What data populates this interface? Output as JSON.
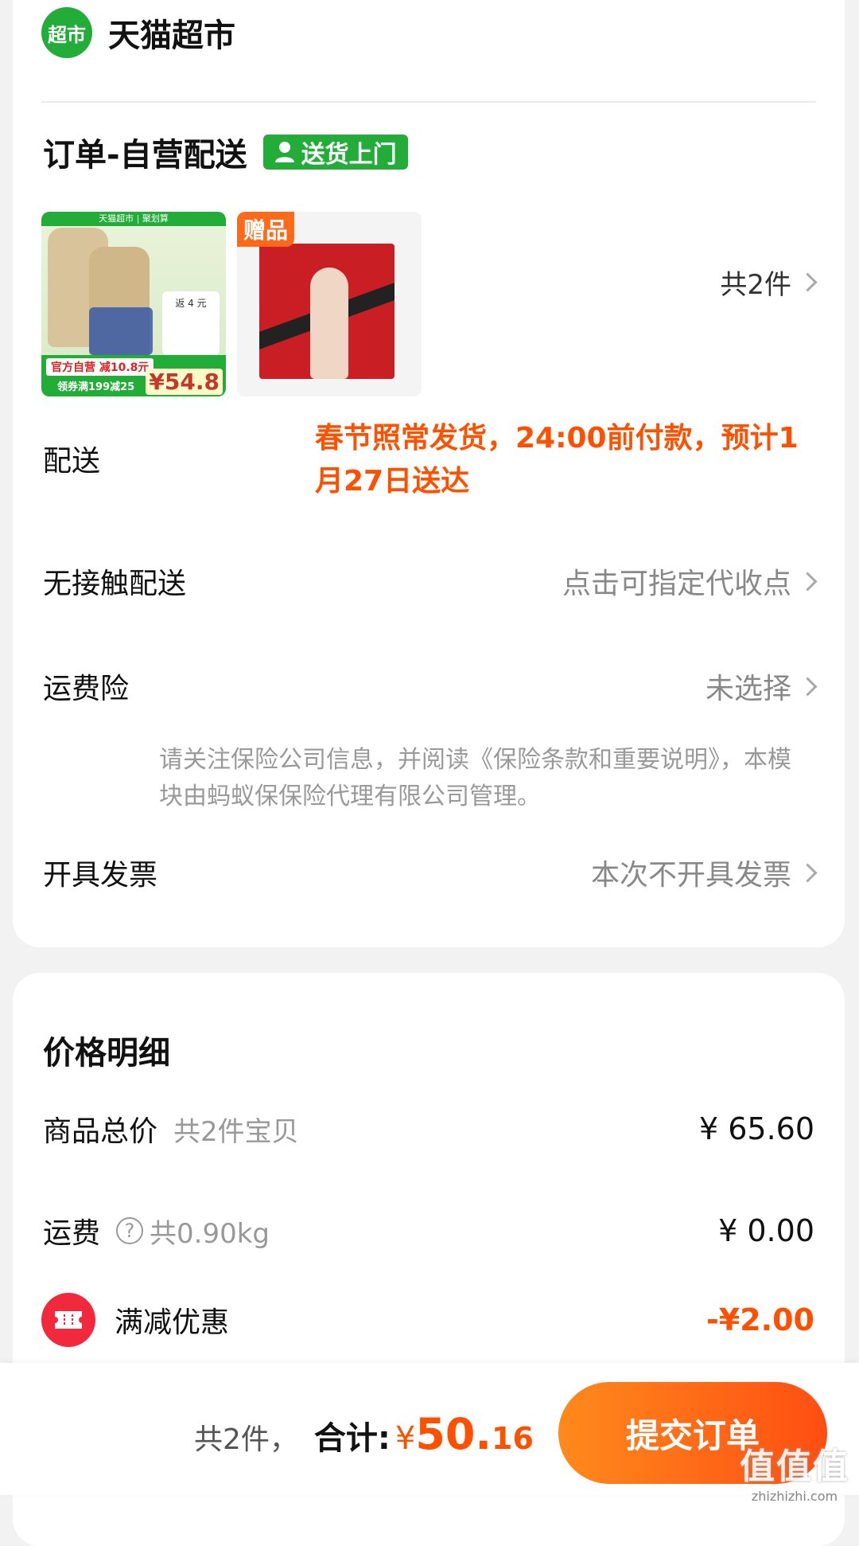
{
  "store": {
    "logo_text": "超市",
    "name": "天猫超市"
  },
  "order": {
    "title": "订单-自营配送",
    "tag": "送货上门",
    "thumb1": {
      "top_text": "天猫超市 | 聚划算",
      "badge": "返 4 元",
      "promo": "官方自营 减10.8元",
      "coupon": "领券满199减25",
      "price": "¥54.8"
    },
    "thumb2": {
      "label": "赠品"
    },
    "item_count": "共2件"
  },
  "rows": {
    "delivery": {
      "label": "配送",
      "value": "春节照常发货，24:00前付款，预计1月27日送达"
    },
    "contactless": {
      "label": "无接触配送",
      "value": "点击可指定代收点"
    },
    "shipping_insurance": {
      "label": "运费险",
      "value": "未选择",
      "notice": "请关注保险公司信息，并阅读《保险条款和重要说明》，本模块由蚂蚁保保险代理有限公司管理。"
    },
    "invoice": {
      "label": "开具发票",
      "value": "本次不开具发票"
    }
  },
  "price": {
    "title": "价格明细",
    "goods_total": {
      "label": "商品总价",
      "sub": "共2件宝贝",
      "amount": "¥ 65.60"
    },
    "shipping": {
      "label": "运费",
      "help": "?",
      "sub": "共0.90kg",
      "amount": "¥ 0.00"
    },
    "discount": {
      "label": "满减优惠",
      "amount": "-¥2.00"
    }
  },
  "footer": {
    "count": "共2件，",
    "total_label": "合计:",
    "currency": "¥",
    "total_int": "50.",
    "total_dec": "16",
    "submit": "提交订单",
    "watermark_big": "值值值",
    "watermark_small": "zhizhizhi.com"
  },
  "colors": {
    "brand_green": "#22ac38",
    "accent_orange": "#ff5000",
    "discount_red": "#f2283c"
  }
}
